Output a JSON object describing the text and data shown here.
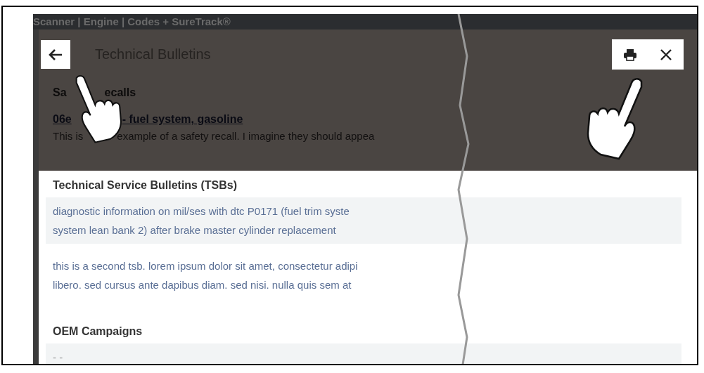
{
  "app_bar": {
    "title": "Scanner | Engine | Codes + SureTrack®"
  },
  "header": {
    "title": "Technical Bulletins"
  },
  "safety_recalls": {
    "heading_parts": [
      "Sa",
      "ecalls"
    ],
    "items": [
      {
        "title_parts": [
          "06e",
          "- fuel system, gasoline"
        ],
        "description_parts": [
          "This is",
          "example of a safety recall. I imagine they should appea"
        ]
      }
    ]
  },
  "tsbs": {
    "heading": "Technical Service Bulletins (TSBs)",
    "items": [
      {
        "lines": [
          "diagnostic information on mil/ses with dtc P0171 (fuel trim syste",
          "system lean bank 2) after brake master cylinder replacement"
        ],
        "shaded": true
      },
      {
        "lines": [
          "this is a second tsb. lorem ipsum dolor sit amet, consectetur adipi",
          "libero. sed cursus ante dapibus diam. sed nisi. nulla quis sem at"
        ],
        "shaded": false
      }
    ]
  },
  "oem_campaigns": {
    "heading": "OEM Campaigns",
    "items": [
      {
        "lines": [
          "- -"
        ],
        "shaded": true
      }
    ]
  }
}
